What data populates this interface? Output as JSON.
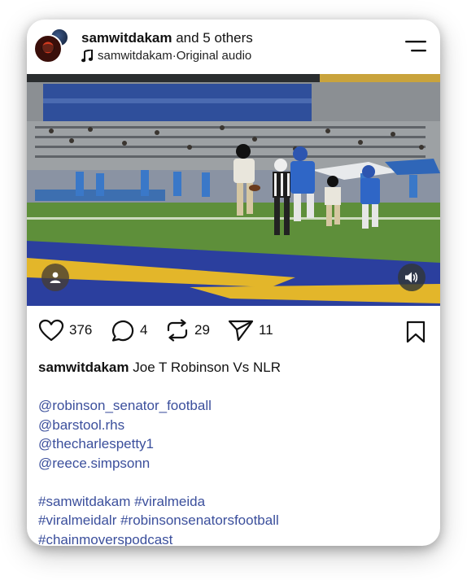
{
  "header": {
    "username": "samwitdakam",
    "others_text": " and 5 others",
    "audio_user": "samwitdakam",
    "audio_sep": " · ",
    "audio_label": "Original audio"
  },
  "actions": {
    "likes": "376",
    "comments": "4",
    "reposts": "29",
    "shares": "11"
  },
  "caption": {
    "username": "samwitdakam",
    "text": "Joe T Robinson Vs NLR",
    "mentions": [
      "@robinson_senator_football",
      "@barstool.rhs",
      "@thecharlespetty1",
      "@reece.simpsonn"
    ],
    "hashtags_line1": "#samwitdakam #viralmeida",
    "hashtags_line2": "#viralmeidalr #robinsonsenatorsfootball",
    "hashtags_line3": "#chainmoverspodcast"
  },
  "icons": {
    "menu": "menu-icon",
    "music": "music-note-icon",
    "heart": "heart-icon",
    "comment": "comment-icon",
    "repost": "repost-icon",
    "share": "share-icon",
    "bookmark": "bookmark-icon",
    "person": "person-icon",
    "volume": "volume-icon"
  },
  "colors": {
    "link": "#3b4f9c",
    "text": "#111111",
    "field_green": "#5e8f3a",
    "end_zone_blue": "#2b3f9e",
    "end_zone_gold": "#e3b62a"
  }
}
